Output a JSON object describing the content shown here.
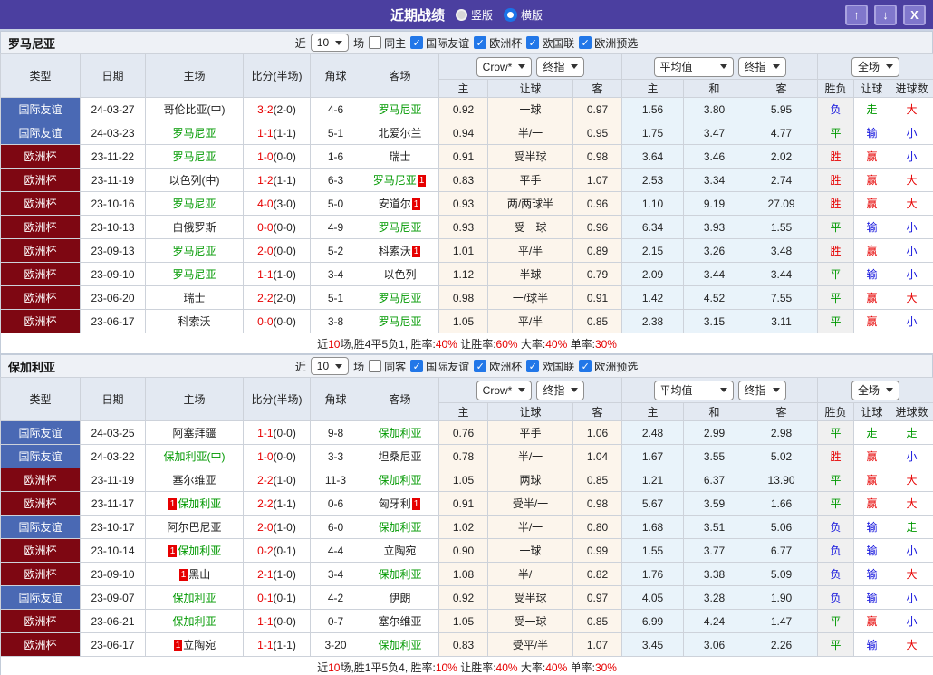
{
  "titlebar": {
    "title": "近期战绩",
    "radios": [
      {
        "label": "竖版",
        "checked": false
      },
      {
        "label": "横版",
        "checked": true
      }
    ],
    "buttons": {
      "up": "↑",
      "down": "↓",
      "close": "X"
    }
  },
  "table": {
    "controls": {
      "near_label": "近",
      "rows_value": "10",
      "games_label": "场",
      "odds_book": "Crow*",
      "final_label": "终指",
      "average_label": "平均值",
      "scope_label": "全场"
    },
    "filters": [
      "国际友谊",
      "欧洲杯",
      "欧国联",
      "欧洲预选"
    ],
    "columns": [
      "类型",
      "日期",
      "主场",
      "比分(半场)",
      "角球",
      "客场"
    ],
    "sub_columns": [
      "主",
      "让球",
      "客",
      "主",
      "和",
      "客",
      "胜负",
      "让球",
      "进球数"
    ]
  },
  "league_colors": {
    "国际友谊": "#4a69b4",
    "欧洲杯": "#7e0712"
  },
  "result_colors": {
    "胜": "#e60000",
    "平": "#009900",
    "负": "#1414dd",
    "赢": "#e60000",
    "输": "#1414dd",
    "走": "#009900",
    "大": "#e60000",
    "小": "#1414dd"
  },
  "accents": {
    "main_team": "#009900",
    "score": "#e60000",
    "badge_bg": "#e60000",
    "summary_red": "#e60000"
  },
  "sections": [
    {
      "team": "罗马尼亚",
      "same_label": "同主",
      "rows": [
        {
          "league": "国际友谊",
          "date": "24-03-27",
          "home": "哥伦比亚(中)",
          "home_main": false,
          "home_red": "",
          "score": "3-2",
          "half": "(2-0)",
          "corners": "4-6",
          "away": "罗马尼亚",
          "away_main": true,
          "away_red": "",
          "h_odds": "0.92",
          "handicap": "一球",
          "a_odds": "0.97",
          "avg_home": "1.56",
          "avg_draw": "3.80",
          "avg_away": "5.95",
          "result": "负",
          "handicap_result": "走",
          "goals_result": "大"
        },
        {
          "league": "国际友谊",
          "date": "24-03-23",
          "home": "罗马尼亚",
          "home_main": true,
          "home_red": "",
          "score": "1-1",
          "half": "(1-1)",
          "corners": "5-1",
          "away": "北爱尔兰",
          "away_main": false,
          "away_red": "",
          "h_odds": "0.94",
          "handicap": "半/一",
          "a_odds": "0.95",
          "avg_home": "1.75",
          "avg_draw": "3.47",
          "avg_away": "4.77",
          "result": "平",
          "handicap_result": "输",
          "goals_result": "小"
        },
        {
          "league": "欧洲杯",
          "date": "23-11-22",
          "home": "罗马尼亚",
          "home_main": true,
          "home_red": "",
          "score": "1-0",
          "half": "(0-0)",
          "corners": "1-6",
          "away": "瑞士",
          "away_main": false,
          "away_red": "",
          "h_odds": "0.91",
          "handicap": "受半球",
          "a_odds": "0.98",
          "avg_home": "3.64",
          "avg_draw": "3.46",
          "avg_away": "2.02",
          "result": "胜",
          "handicap_result": "赢",
          "goals_result": "小"
        },
        {
          "league": "欧洲杯",
          "date": "23-11-19",
          "home": "以色列(中)",
          "home_main": false,
          "home_red": "",
          "score": "1-2",
          "half": "(1-1)",
          "corners": "6-3",
          "away": "罗马尼亚",
          "away_main": true,
          "away_red": "1",
          "h_odds": "0.83",
          "handicap": "平手",
          "a_odds": "1.07",
          "avg_home": "2.53",
          "avg_draw": "3.34",
          "avg_away": "2.74",
          "result": "胜",
          "handicap_result": "赢",
          "goals_result": "大"
        },
        {
          "league": "欧洲杯",
          "date": "23-10-16",
          "home": "罗马尼亚",
          "home_main": true,
          "home_red": "",
          "score": "4-0",
          "half": "(3-0)",
          "corners": "5-0",
          "away": "安道尔",
          "away_main": false,
          "away_red": "1",
          "h_odds": "0.93",
          "handicap": "两/两球半",
          "a_odds": "0.96",
          "avg_home": "1.10",
          "avg_draw": "9.19",
          "avg_away": "27.09",
          "result": "胜",
          "handicap_result": "赢",
          "goals_result": "大"
        },
        {
          "league": "欧洲杯",
          "date": "23-10-13",
          "home": "白俄罗斯",
          "home_main": false,
          "home_red": "",
          "score": "0-0",
          "half": "(0-0)",
          "corners": "4-9",
          "away": "罗马尼亚",
          "away_main": true,
          "away_red": "",
          "h_odds": "0.93",
          "handicap": "受一球",
          "a_odds": "0.96",
          "avg_home": "6.34",
          "avg_draw": "3.93",
          "avg_away": "1.55",
          "result": "平",
          "handicap_result": "输",
          "goals_result": "小"
        },
        {
          "league": "欧洲杯",
          "date": "23-09-13",
          "home": "罗马尼亚",
          "home_main": true,
          "home_red": "",
          "score": "2-0",
          "half": "(0-0)",
          "corners": "5-2",
          "away": "科索沃",
          "away_main": false,
          "away_red": "1",
          "h_odds": "1.01",
          "handicap": "平/半",
          "a_odds": "0.89",
          "avg_home": "2.15",
          "avg_draw": "3.26",
          "avg_away": "3.48",
          "result": "胜",
          "handicap_result": "赢",
          "goals_result": "小"
        },
        {
          "league": "欧洲杯",
          "date": "23-09-10",
          "home": "罗马尼亚",
          "home_main": true,
          "home_red": "",
          "score": "1-1",
          "half": "(1-0)",
          "corners": "3-4",
          "away": "以色列",
          "away_main": false,
          "away_red": "",
          "h_odds": "1.12",
          "handicap": "半球",
          "a_odds": "0.79",
          "avg_home": "2.09",
          "avg_draw": "3.44",
          "avg_away": "3.44",
          "result": "平",
          "handicap_result": "输",
          "goals_result": "小"
        },
        {
          "league": "欧洲杯",
          "date": "23-06-20",
          "home": "瑞士",
          "home_main": false,
          "home_red": "",
          "score": "2-2",
          "half": "(2-0)",
          "corners": "5-1",
          "away": "罗马尼亚",
          "away_main": true,
          "away_red": "",
          "h_odds": "0.98",
          "handicap": "一/球半",
          "a_odds": "0.91",
          "avg_home": "1.42",
          "avg_draw": "4.52",
          "avg_away": "7.55",
          "result": "平",
          "handicap_result": "赢",
          "goals_result": "大"
        },
        {
          "league": "欧洲杯",
          "date": "23-06-17",
          "home": "科索沃",
          "home_main": false,
          "home_red": "",
          "score": "0-0",
          "half": "(0-0)",
          "corners": "3-8",
          "away": "罗马尼亚",
          "away_main": true,
          "away_red": "",
          "h_odds": "1.05",
          "handicap": "平/半",
          "a_odds": "0.85",
          "avg_home": "2.38",
          "avg_draw": "3.15",
          "avg_away": "3.11",
          "result": "平",
          "handicap_result": "赢",
          "goals_result": "小"
        }
      ],
      "summary": [
        {
          "t": "近"
        },
        {
          "t": "10",
          "r": true
        },
        {
          "t": "场,胜4平5负1, 胜率:"
        },
        {
          "t": "40%",
          "r": true
        },
        {
          "t": " 让胜率:"
        },
        {
          "t": "60%",
          "r": true
        },
        {
          "t": " 大率:"
        },
        {
          "t": "40%",
          "r": true
        },
        {
          "t": " 单率:"
        },
        {
          "t": "30%",
          "r": true
        }
      ]
    },
    {
      "team": "保加利亚",
      "same_label": "同客",
      "rows": [
        {
          "league": "国际友谊",
          "date": "24-03-25",
          "home": "阿塞拜疆",
          "home_main": false,
          "home_red": "",
          "score": "1-1",
          "half": "(0-0)",
          "corners": "9-8",
          "away": "保加利亚",
          "away_main": true,
          "away_red": "",
          "h_odds": "0.76",
          "handicap": "平手",
          "a_odds": "1.06",
          "avg_home": "2.48",
          "avg_draw": "2.99",
          "avg_away": "2.98",
          "result": "平",
          "handicap_result": "走",
          "goals_result": "走"
        },
        {
          "league": "国际友谊",
          "date": "24-03-22",
          "home": "保加利亚(中)",
          "home_main": true,
          "home_red": "",
          "score": "1-0",
          "half": "(0-0)",
          "corners": "3-3",
          "away": "坦桑尼亚",
          "away_main": false,
          "away_red": "",
          "h_odds": "0.78",
          "handicap": "半/一",
          "a_odds": "1.04",
          "avg_home": "1.67",
          "avg_draw": "3.55",
          "avg_away": "5.02",
          "result": "胜",
          "handicap_result": "赢",
          "goals_result": "小"
        },
        {
          "league": "欧洲杯",
          "date": "23-11-19",
          "home": "塞尔维亚",
          "home_main": false,
          "home_red": "",
          "score": "2-2",
          "half": "(1-0)",
          "corners": "11-3",
          "away": "保加利亚",
          "away_main": true,
          "away_red": "",
          "h_odds": "1.05",
          "handicap": "两球",
          "a_odds": "0.85",
          "avg_home": "1.21",
          "avg_draw": "6.37",
          "avg_away": "13.90",
          "result": "平",
          "handicap_result": "赢",
          "goals_result": "大"
        },
        {
          "league": "欧洲杯",
          "date": "23-11-17",
          "home": "保加利亚",
          "home_main": true,
          "home_red": "1",
          "score": "2-2",
          "half": "(1-1)",
          "corners": "0-6",
          "away": "匈牙利",
          "away_main": false,
          "away_red": "1",
          "h_odds": "0.91",
          "handicap": "受半/一",
          "a_odds": "0.98",
          "avg_home": "5.67",
          "avg_draw": "3.59",
          "avg_away": "1.66",
          "result": "平",
          "handicap_result": "赢",
          "goals_result": "大"
        },
        {
          "league": "国际友谊",
          "date": "23-10-17",
          "home": "阿尔巴尼亚",
          "home_main": false,
          "home_red": "",
          "score": "2-0",
          "half": "(1-0)",
          "corners": "6-0",
          "away": "保加利亚",
          "away_main": true,
          "away_red": "",
          "h_odds": "1.02",
          "handicap": "半/一",
          "a_odds": "0.80",
          "avg_home": "1.68",
          "avg_draw": "3.51",
          "avg_away": "5.06",
          "result": "负",
          "handicap_result": "输",
          "goals_result": "走"
        },
        {
          "league": "欧洲杯",
          "date": "23-10-14",
          "home": "保加利亚",
          "home_main": true,
          "home_red": "1",
          "score": "0-2",
          "half": "(0-1)",
          "corners": "4-4",
          "away": "立陶宛",
          "away_main": false,
          "away_red": "",
          "h_odds": "0.90",
          "handicap": "一球",
          "a_odds": "0.99",
          "avg_home": "1.55",
          "avg_draw": "3.77",
          "avg_away": "6.77",
          "result": "负",
          "handicap_result": "输",
          "goals_result": "小"
        },
        {
          "league": "欧洲杯",
          "date": "23-09-10",
          "home": "黑山",
          "home_main": false,
          "home_red": "1",
          "score": "2-1",
          "half": "(1-0)",
          "corners": "3-4",
          "away": "保加利亚",
          "away_main": true,
          "away_red": "",
          "h_odds": "1.08",
          "handicap": "半/一",
          "a_odds": "0.82",
          "avg_home": "1.76",
          "avg_draw": "3.38",
          "avg_away": "5.09",
          "result": "负",
          "handicap_result": "输",
          "goals_result": "大"
        },
        {
          "league": "国际友谊",
          "date": "23-09-07",
          "home": "保加利亚",
          "home_main": true,
          "home_red": "",
          "score": "0-1",
          "half": "(0-1)",
          "corners": "4-2",
          "away": "伊朗",
          "away_main": false,
          "away_red": "",
          "h_odds": "0.92",
          "handicap": "受半球",
          "a_odds": "0.97",
          "avg_home": "4.05",
          "avg_draw": "3.28",
          "avg_away": "1.90",
          "result": "负",
          "handicap_result": "输",
          "goals_result": "小"
        },
        {
          "league": "欧洲杯",
          "date": "23-06-21",
          "home": "保加利亚",
          "home_main": true,
          "home_red": "",
          "score": "1-1",
          "half": "(0-0)",
          "corners": "0-7",
          "away": "塞尔维亚",
          "away_main": false,
          "away_red": "",
          "h_odds": "1.05",
          "handicap": "受一球",
          "a_odds": "0.85",
          "avg_home": "6.99",
          "avg_draw": "4.24",
          "avg_away": "1.47",
          "result": "平",
          "handicap_result": "赢",
          "goals_result": "小"
        },
        {
          "league": "欧洲杯",
          "date": "23-06-17",
          "home": "立陶宛",
          "home_main": false,
          "home_red": "1",
          "score": "1-1",
          "half": "(1-1)",
          "corners": "3-20",
          "away": "保加利亚",
          "away_main": true,
          "away_red": "",
          "h_odds": "0.83",
          "handicap": "受平/半",
          "a_odds": "1.07",
          "avg_home": "3.45",
          "avg_draw": "3.06",
          "avg_away": "2.26",
          "result": "平",
          "handicap_result": "输",
          "goals_result": "大"
        }
      ],
      "summary": [
        {
          "t": "近"
        },
        {
          "t": "10",
          "r": true
        },
        {
          "t": "场,胜1平5负4, 胜率:"
        },
        {
          "t": "10%",
          "r": true
        },
        {
          "t": " 让胜率:"
        },
        {
          "t": "40%",
          "r": true
        },
        {
          "t": " 大率:"
        },
        {
          "t": "40%",
          "r": true
        },
        {
          "t": " 单率:"
        },
        {
          "t": "30%",
          "r": true
        }
      ]
    }
  ]
}
